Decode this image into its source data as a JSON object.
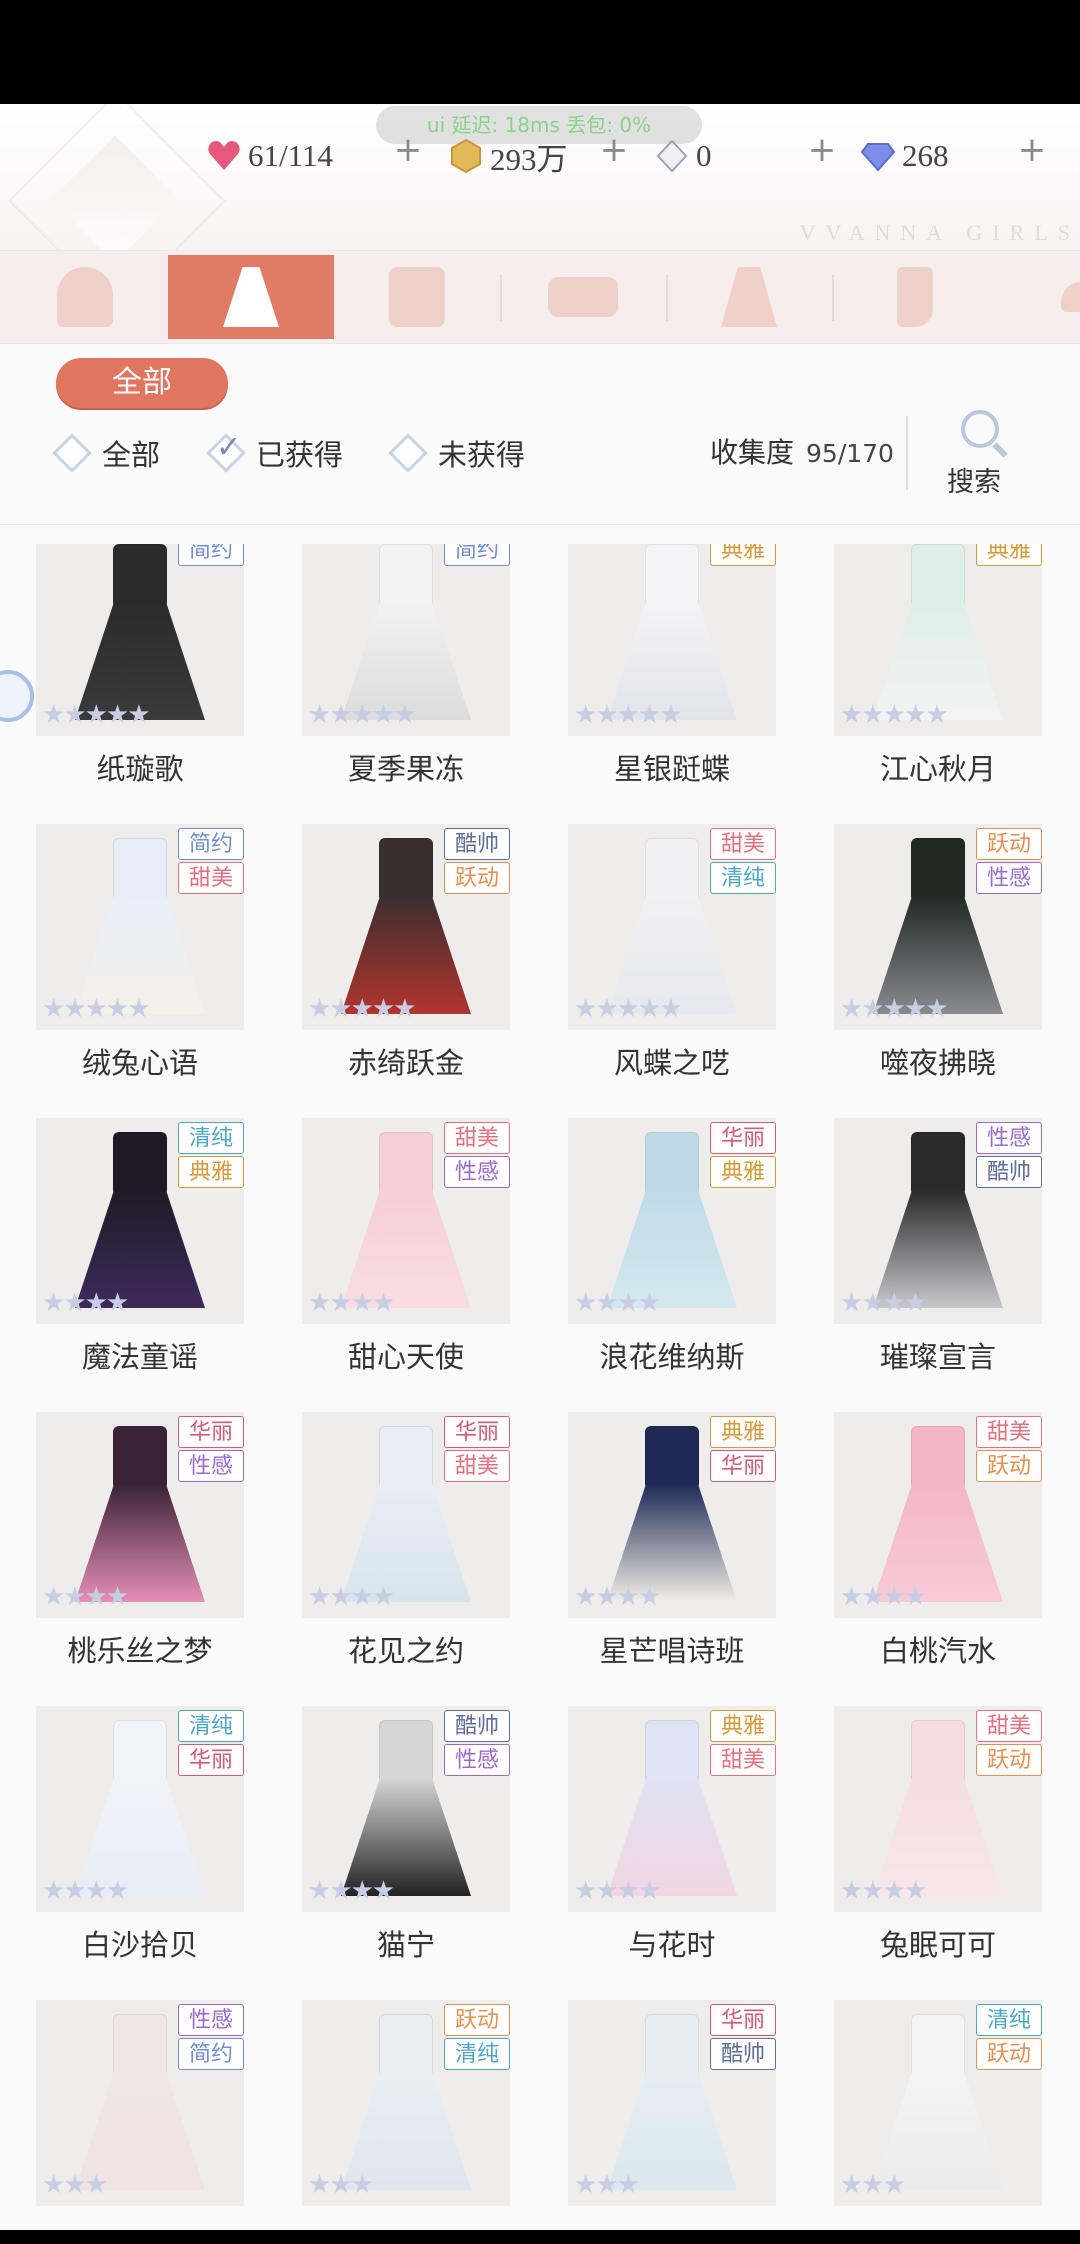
{
  "top_bar": {
    "perf_text": "ui 延迟: 18ms  丢包: 0%",
    "hearts": "61/114",
    "coins": "293万",
    "crystals": "0",
    "diamonds": "268",
    "plus": "+",
    "brand": "VVANNA GIRLS"
  },
  "category_tabs": [
    {
      "icon": "hair-icon"
    },
    {
      "icon": "dress-icon",
      "active": true
    },
    {
      "icon": "coat-icon"
    },
    {
      "icon": "top-icon"
    },
    {
      "icon": "skirt-icon"
    },
    {
      "icon": "socks-icon"
    },
    {
      "icon": "shoes-icon"
    }
  ],
  "subcategory": {
    "label": "全部"
  },
  "filters": {
    "all": "全部",
    "obtained": "已获得",
    "not_obtained": "未获得",
    "collection_label": "收集度",
    "collection_value": "95/170",
    "search_label": "搜索"
  },
  "colors": {
    "accent": "#e07b66",
    "tag_simple": "#6f8fd0",
    "tag_elegant": "#d69a3a",
    "tag_cool": "#5d6f9c",
    "tag_sweet": "#e4717d",
    "tag_active": "#e59050",
    "tag_sexy": "#9a6ad0",
    "tag_pure": "#4aa9c9",
    "tag_gorgeous": "#d45a78"
  },
  "items": [
    {
      "name": "纸璇歌",
      "tags": [
        "简约"
      ],
      "stars": 5,
      "palette": [
        "#2b2b2b",
        "#3a3a3a"
      ]
    },
    {
      "name": "夏季果冻",
      "tags": [
        "简约"
      ],
      "stars": 5,
      "palette": [
        "#f2f2f2",
        "#dcdcdc"
      ]
    },
    {
      "name": "星银跹蝶",
      "tags": [
        "典雅"
      ],
      "stars": 5,
      "palette": [
        "#f4f4f6",
        "#e3e4ea"
      ]
    },
    {
      "name": "江心秋月",
      "tags": [
        "典雅"
      ],
      "stars": 5,
      "palette": [
        "#dfeee8",
        "#f3f3f3"
      ]
    },
    {
      "name": "绒兔心语",
      "tags": [
        "简约",
        "甜美"
      ],
      "stars": 5,
      "palette": [
        "#e8eef8",
        "#f4f0ea"
      ]
    },
    {
      "name": "赤绮跃金",
      "tags": [
        "酷帅",
        "跃动"
      ],
      "stars": 5,
      "palette": [
        "#3a2f2f",
        "#b2342e"
      ]
    },
    {
      "name": "风蝶之呓",
      "tags": [
        "甜美",
        "清纯"
      ],
      "stars": 5,
      "palette": [
        "#f1f1f3",
        "#e7e8ee"
      ]
    },
    {
      "name": "噬夜拂晓",
      "tags": [
        "跃动",
        "性感"
      ],
      "stars": 5,
      "palette": [
        "#1f2a25",
        "#8a8a8e"
      ]
    },
    {
      "name": "魔法童谣",
      "tags": [
        "清纯",
        "典雅"
      ],
      "stars": 4,
      "palette": [
        "#1e1b26",
        "#3e2a5c"
      ]
    },
    {
      "name": "甜心天使",
      "tags": [
        "甜美",
        "性感"
      ],
      "stars": 4,
      "palette": [
        "#f6cfd6",
        "#f8dde3"
      ]
    },
    {
      "name": "浪花维纳斯",
      "tags": [
        "华丽",
        "典雅"
      ],
      "stars": 4,
      "palette": [
        "#bfdbe8",
        "#d4e8f0"
      ]
    },
    {
      "name": "璀璨宣言",
      "tags": [
        "性感",
        "酷帅"
      ],
      "stars": 4,
      "palette": [
        "#2a2a2a",
        "#c8c8cc"
      ]
    },
    {
      "name": "桃乐丝之梦",
      "tags": [
        "华丽",
        "性感"
      ],
      "stars": 4,
      "palette": [
        "#3a2336",
        "#e58fb6"
      ]
    },
    {
      "name": "花见之约",
      "tags": [
        "华丽",
        "甜美"
      ],
      "stars": 4,
      "palette": [
        "#e8eef4",
        "#d9e4ee"
      ]
    },
    {
      "name": "星芒唱诗班",
      "tags": [
        "典雅",
        "华丽"
      ],
      "stars": 4,
      "palette": [
        "#1e2a55",
        "#f2efe8"
      ]
    },
    {
      "name": "白桃汽水",
      "tags": [
        "甜美",
        "跃动"
      ],
      "stars": 4,
      "palette": [
        "#f4b6c7",
        "#f7cad6"
      ]
    },
    {
      "name": "白沙拾贝",
      "tags": [
        "清纯",
        "华丽"
      ],
      "stars": 4,
      "palette": [
        "#f1f3f8",
        "#e8eef6"
      ]
    },
    {
      "name": "猫宁",
      "tags": [
        "酷帅",
        "性感"
      ],
      "stars": 4,
      "palette": [
        "#d6d6d6",
        "#222222"
      ]
    },
    {
      "name": "与花时",
      "tags": [
        "典雅",
        "甜美"
      ],
      "stars": 4,
      "palette": [
        "#dfe3f4",
        "#f2d5e2"
      ]
    },
    {
      "name": "兔眠可可",
      "tags": [
        "甜美",
        "跃动"
      ],
      "stars": 4,
      "palette": [
        "#f6dde4",
        "#f8e6ea"
      ]
    },
    {
      "name": "",
      "tags": [
        "性感",
        "简约"
      ],
      "stars": 3,
      "palette": [
        "#f0e6e6",
        "#efe3e3"
      ]
    },
    {
      "name": "",
      "tags": [
        "跃动",
        "清纯"
      ],
      "stars": 3,
      "palette": [
        "#e8eef2",
        "#dfe6ee"
      ]
    },
    {
      "name": "",
      "tags": [
        "华丽",
        "酷帅"
      ],
      "stars": 3,
      "palette": [
        "#e6eef2",
        "#dbe8ee"
      ]
    },
    {
      "name": "",
      "tags": [
        "清纯",
        "跃动"
      ],
      "stars": 3,
      "palette": [
        "#f4f4f4",
        "#ebebeb"
      ]
    }
  ]
}
